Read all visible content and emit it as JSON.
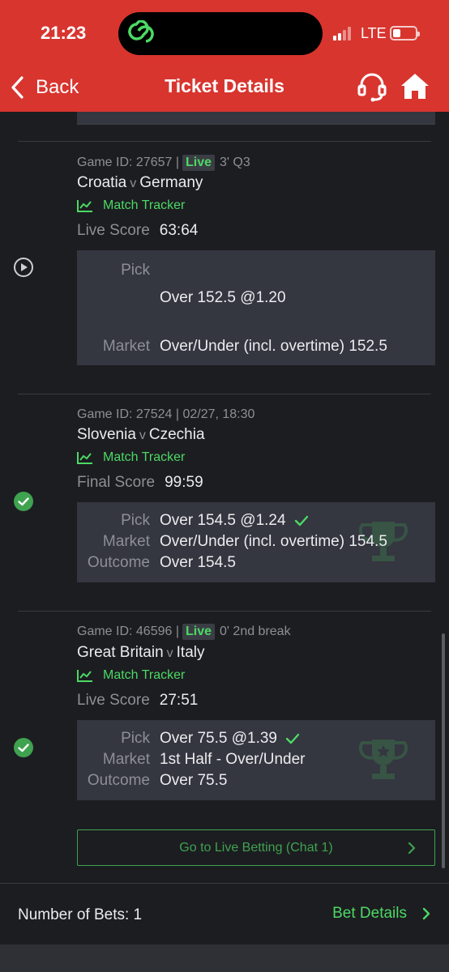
{
  "status_bar": {
    "time": "21:23",
    "network": "LTE"
  },
  "header": {
    "back_label": "Back",
    "title": "Ticket Details"
  },
  "colors": {
    "header": "#d8352f",
    "accent_green": "#4cd964",
    "background": "#1c1d21",
    "card": "#343640"
  },
  "icons": [
    "chevron-left-icon",
    "headset-icon",
    "home-icon",
    "play-circle-icon",
    "check-circle-icon",
    "chart-icon",
    "check-icon",
    "trophy-icon",
    "chevron-right-icon"
  ],
  "bets": [
    {
      "game_id": "Game ID: 27657 |",
      "live": "Live",
      "clock": "3' Q3",
      "team1": "Croatia",
      "vs": "v",
      "team2": "Germany",
      "tracker": "Match Tracker",
      "score_label": "Live Score",
      "score": "63:64",
      "pick_label": "Pick",
      "pick": "Over 152.5 @1.20",
      "market_label": "Market",
      "market": "Over/Under (incl. overtime) 152.5",
      "status": "live"
    },
    {
      "game_id": "Game ID: 27524 | 02/27, 18:30",
      "team1": "Slovenia",
      "vs": "v",
      "team2": "Czechia",
      "tracker": "Match Tracker",
      "score_label": "Final Score",
      "score": "99:59",
      "pick_label": "Pick",
      "pick": "Over 154.5 @1.24",
      "market_label": "Market",
      "market": "Over/Under (incl. overtime) 154.5",
      "outcome_label": "Outcome",
      "outcome": "Over 154.5",
      "status": "won"
    },
    {
      "game_id": "Game ID: 46596 |",
      "live": "Live",
      "clock": "0' 2nd break",
      "team1": "Great Britain",
      "vs": "v",
      "team2": "Italy",
      "tracker": "Match Tracker",
      "score_label": "Live Score",
      "score": "27:51",
      "pick_label": "Pick",
      "pick": "Over 75.5 @1.39",
      "market_label": "Market",
      "market": "1st Half - Over/Under",
      "outcome_label": "Outcome",
      "outcome": "Over 75.5",
      "status": "won"
    }
  ],
  "live_betting_button": "Go to Live Betting (Chat 1)",
  "footer": {
    "number_of_bets": "Number of Bets: 1",
    "bet_details": "Bet Details"
  }
}
